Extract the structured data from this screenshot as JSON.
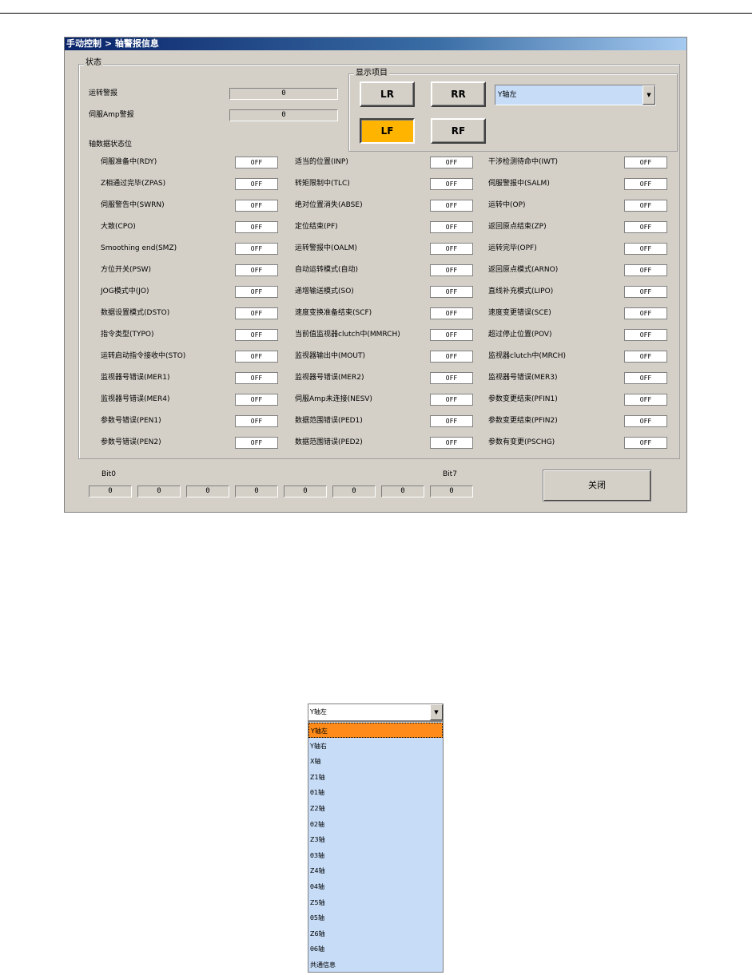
{
  "window": {
    "title": "手动控制 > 轴警报信息"
  },
  "status_group": {
    "legend": "状态"
  },
  "alarm": {
    "run_alarm_label": "运转警报",
    "run_alarm_value": "0",
    "servo_alarm_label": "伺服Amp警报",
    "servo_alarm_value": "0"
  },
  "display": {
    "legend": "显示项目",
    "buttons": [
      "LR",
      "RR",
      "LF",
      "RF"
    ],
    "active_button": "LF",
    "selected_axis": "Y轴左"
  },
  "axis_status_label": "轴数据状态位",
  "status_rows": [
    [
      {
        "label": "伺服准备中(RDY)",
        "value": "OFF"
      },
      {
        "label": "适当的位置(INP)",
        "value": "OFF"
      },
      {
        "label": "干涉检测待命中(IWT)",
        "value": "OFF"
      }
    ],
    [
      {
        "label": "Z相通过完毕(ZPAS)",
        "value": "OFF"
      },
      {
        "label": "转矩限制中(TLC)",
        "value": "OFF"
      },
      {
        "label": "伺服警报中(SALM)",
        "value": "OFF"
      }
    ],
    [
      {
        "label": "伺服警告中(SWRN)",
        "value": "OFF"
      },
      {
        "label": "绝对位置消失(ABSE)",
        "value": "OFF"
      },
      {
        "label": "运转中(OP)",
        "value": "OFF"
      }
    ],
    [
      {
        "label": "大致(CPO)",
        "value": "OFF"
      },
      {
        "label": "定位结束(PF)",
        "value": "OFF"
      },
      {
        "label": "返回原点结束(ZP)",
        "value": "OFF"
      }
    ],
    [
      {
        "label": "Smoothing end(SMZ)",
        "value": "OFF"
      },
      {
        "label": "运转警报中(OALM)",
        "value": "OFF"
      },
      {
        "label": "运转完毕(OPF)",
        "value": "OFF"
      }
    ],
    [
      {
        "label": "方位开关(PSW)",
        "value": "OFF"
      },
      {
        "label": "自动运转模式(自动)",
        "value": "OFF"
      },
      {
        "label": "返回原点模式(ARNO)",
        "value": "OFF"
      }
    ],
    [
      {
        "label": "JOG模式中(JO)",
        "value": "OFF"
      },
      {
        "label": "递增输送模式(SO)",
        "value": "OFF"
      },
      {
        "label": "直线补充模式(LIPO)",
        "value": "OFF"
      }
    ],
    [
      {
        "label": "数据设置模式(DSTO)",
        "value": "OFF"
      },
      {
        "label": "速度变换准备结束(SCF)",
        "value": "OFF"
      },
      {
        "label": "速度变更错误(SCE)",
        "value": "OFF"
      }
    ],
    [
      {
        "label": "指令类型(TYPO)",
        "value": "OFF"
      },
      {
        "label": "当前值监视器clutch中(MMRCH)",
        "value": "OFF"
      },
      {
        "label": "超过停止位置(POV)",
        "value": "OFF"
      }
    ],
    [
      {
        "label": "运转启动指令接收中(STO)",
        "value": "OFF"
      },
      {
        "label": "监视器输出中(MOUT)",
        "value": "OFF"
      },
      {
        "label": "监视器clutch中(MRCH)",
        "value": "OFF"
      }
    ],
    [
      {
        "label": "监视器号错误(MER1)",
        "value": "OFF"
      },
      {
        "label": "监视器号错误(MER2)",
        "value": "OFF"
      },
      {
        "label": "监视器号错误(MER3)",
        "value": "OFF"
      }
    ],
    [
      {
        "label": "监视器号错误(MER4)",
        "value": "OFF"
      },
      {
        "label": "伺服Amp未连接(NESV)",
        "value": "OFF"
      },
      {
        "label": "参数变更结束(PFIN1)",
        "value": "OFF"
      }
    ],
    [
      {
        "label": "参数号错误(PEN1)",
        "value": "OFF"
      },
      {
        "label": "数据范围错误(PED1)",
        "value": "OFF"
      },
      {
        "label": "参数变更结束(PFIN2)",
        "value": "OFF"
      }
    ],
    [
      {
        "label": "参数号错误(PEN2)",
        "value": "OFF"
      },
      {
        "label": "数据范围错误(PED2)",
        "value": "OFF"
      },
      {
        "label": "参数有变更(PSCHG)",
        "value": "OFF"
      }
    ]
  ],
  "bits": {
    "start_label": "Bit0",
    "end_label": "Bit7",
    "values": [
      "0",
      "0",
      "0",
      "0",
      "0",
      "0",
      "0",
      "0"
    ]
  },
  "close_label": "关闭",
  "dropdown": {
    "selected": "Y轴左",
    "options": [
      "Y轴左",
      "Y轴右",
      "X轴",
      "Z1轴",
      "θ1轴",
      "Z2轴",
      "θ2轴",
      "Z3轴",
      "θ3轴",
      "Z4轴",
      "θ4轴",
      "Z5轴",
      "θ5轴",
      "Z6轴",
      "θ6轴",
      "共通信息"
    ],
    "highlighted_index": 0
  }
}
